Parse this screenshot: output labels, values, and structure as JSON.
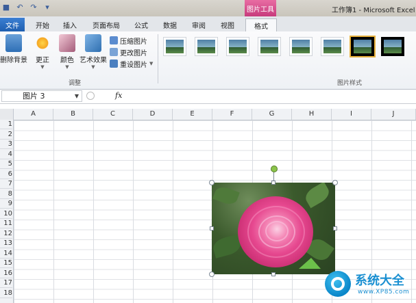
{
  "title_bar": {
    "context_group": "图片工具",
    "app_title": "工作簿1 - Microsoft Excel"
  },
  "tabs": [
    {
      "label": "文件"
    },
    {
      "label": "开始"
    },
    {
      "label": "插入"
    },
    {
      "label": "页面布局"
    },
    {
      "label": "公式"
    },
    {
      "label": "数据"
    },
    {
      "label": "审阅"
    },
    {
      "label": "视图"
    },
    {
      "label": "格式"
    }
  ],
  "ribbon": {
    "remove_background": "删除背景",
    "corrections": "更正",
    "color": "颜色",
    "artistic_effects": "艺术效果",
    "compress": "压缩图片",
    "change": "更改图片",
    "reset": "重设图片",
    "group_adjust": "调整",
    "group_styles": "图片样式"
  },
  "formula_bar": {
    "name_box": "图片 3",
    "fx": "fx"
  },
  "columns": [
    "A",
    "B",
    "C",
    "D",
    "E",
    "F",
    "G",
    "H",
    "I",
    "J"
  ],
  "rows": [
    "1",
    "2",
    "3",
    "4",
    "5",
    "6",
    "7",
    "8",
    "9",
    "10",
    "11",
    "12",
    "13",
    "14",
    "15",
    "16",
    "17",
    "18"
  ],
  "watermark": {
    "name": "系统大全",
    "url": "www.XP85.com"
  },
  "colors": {
    "file_tab": "#1f5fb0",
    "picture_tools": "#c73b7c",
    "watermark": "#1a8fd1"
  }
}
